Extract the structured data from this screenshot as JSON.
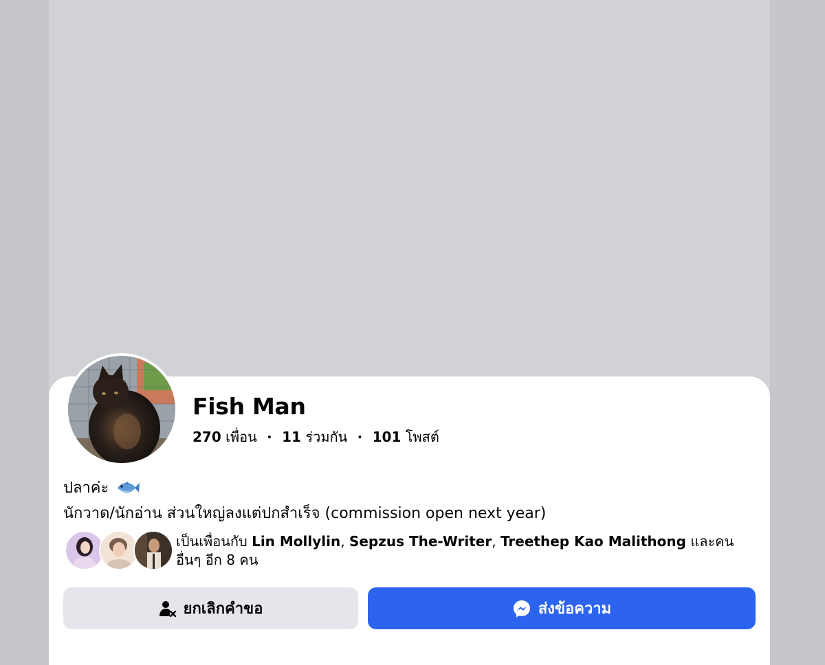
{
  "profile": {
    "name": "Fish Man",
    "stats": {
      "friends_count": "270",
      "friends_label": "เพื่อน",
      "mutual_count": "11",
      "mutual_label": "ร่วมกัน",
      "posts_count": "101",
      "posts_label": "โพสต์",
      "separator": "·"
    },
    "bio": {
      "line1": "ปลาค่ะ",
      "line1_emoji": "fish-emoji",
      "line2": "นักวาด/นักอ่าน ส่วนใหญ่ลงแต่ปกสำเร็จ (commission open next year)"
    },
    "mutual_friends": {
      "prefix": "เป็นเพื่อนกับ",
      "friends": [
        "Lin Mollylin",
        "Sepzus The-Writer",
        "Treethep Kao Malithong"
      ],
      "comma": ",",
      "suffix": "และคนอื่นๆ อีก 8 คน"
    }
  },
  "actions": {
    "cancel_request_label": "ยกเลิกคำขอ",
    "cancel_request_icon": "person-remove-icon",
    "message_label": "ส่งข้อความ",
    "message_icon": "messenger-icon"
  },
  "colors": {
    "cover": "#d1d2d6",
    "message_button": "#2d64ef",
    "secondary_button": "#e4e6eb",
    "text": "#050505"
  }
}
